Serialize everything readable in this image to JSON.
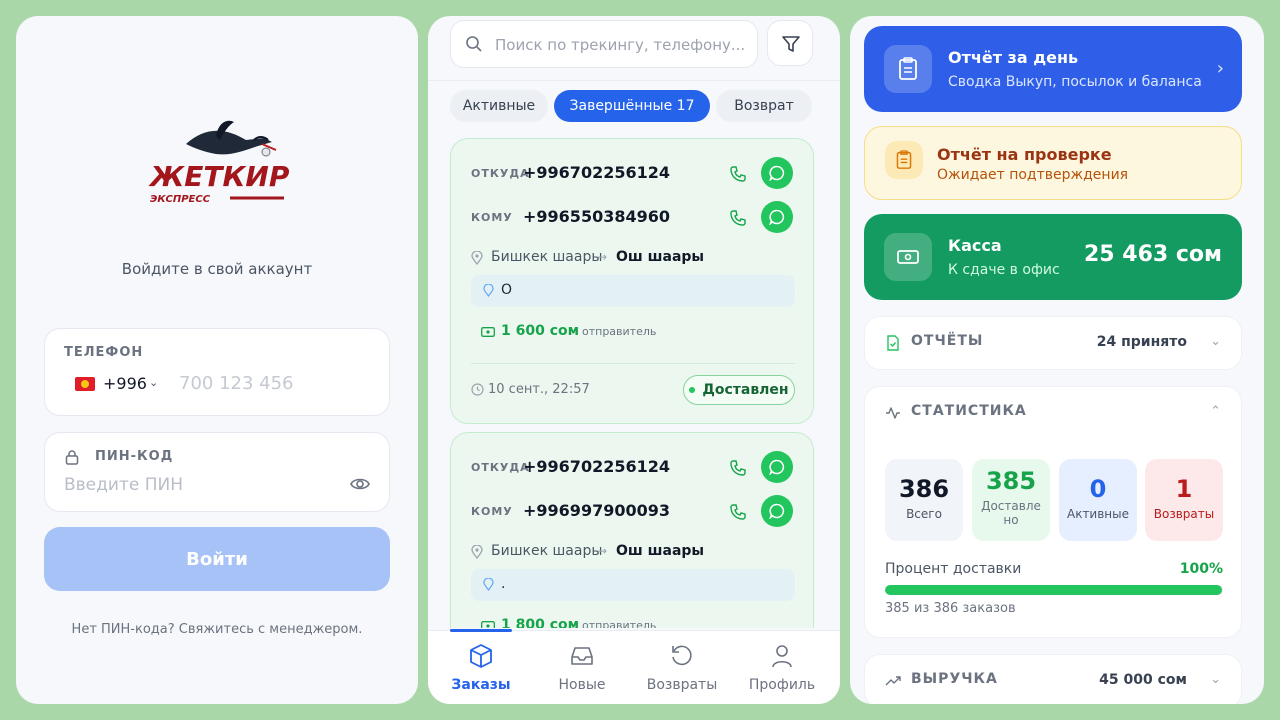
{
  "login": {
    "logo_text": "ЖЕТКИР",
    "logo_sub": "ЭКСПРЕСС",
    "title": "Войдите в свой аккаунт",
    "phone_label": "ТЕЛЕФОН",
    "country_code": "+996",
    "phone_placeholder": "700 123 456",
    "pin_label": "ПИН-КОД",
    "pin_placeholder": "Введите ПИН",
    "login_button": "Войти",
    "no_pin_text": "Нет ПИН-кода? Свяжитесь с менеджером."
  },
  "orders": {
    "search_placeholder": "Поиск по трекингу, телефону...",
    "tabs": [
      {
        "label": "Активные"
      },
      {
        "label": "Завершённые 17"
      },
      {
        "label": "Возврат"
      }
    ],
    "cards": [
      {
        "from_label": "ОТКУДА",
        "from_phone": "+996702256124",
        "to_label": "КОМУ",
        "to_phone": "+996550384960",
        "route_from": "Бишкек шаары",
        "route_to": "Ош шаары",
        "address": "О",
        "amount": "1 600 сом",
        "payer": "· отправитель",
        "date": "10 сент., 22:57",
        "status": "Доставлен"
      },
      {
        "from_label": "ОТКУДА",
        "from_phone": "+996702256124",
        "to_label": "КОМУ",
        "to_phone": "+996997900093",
        "route_from": "Бишкек шаары",
        "route_to": "Ош шаары",
        "address": ".",
        "amount": "1 800 сом",
        "payer": "· отправитель"
      }
    ],
    "nav": [
      {
        "label": "Заказы"
      },
      {
        "label": "Новые"
      },
      {
        "label": "Возвраты"
      },
      {
        "label": "Профиль"
      }
    ]
  },
  "dashboard": {
    "daily": {
      "title": "Отчёт за день",
      "subtitle": "Сводка Выкуп, посылок и баланса"
    },
    "check": {
      "title": "Отчёт на проверке",
      "subtitle": "Ожидает подтверждения"
    },
    "kassa": {
      "title": "Касса",
      "subtitle": "К сдаче в офис",
      "balance": "25 463 сом"
    },
    "reports": {
      "title": "ОТЧЁТЫ",
      "value": "24 принято"
    },
    "stats": {
      "title": "СТАТИСТИКА",
      "items": [
        {
          "value": "386",
          "label": "Всего"
        },
        {
          "value": "385",
          "label": "Доставле но"
        },
        {
          "value": "0",
          "label": "Активные"
        },
        {
          "value": "1",
          "label": "Возвраты"
        }
      ],
      "percent_label": "Процент доставки",
      "percent_value": "100%",
      "percent_fraction": 0.997,
      "summary": "385 из 386 заказов"
    },
    "revenue": {
      "title": "ВЫРУЧКА",
      "value": "45 000 сом"
    }
  },
  "colors": {
    "primary": "#2563eb",
    "success": "#22c55e",
    "kassa": "#149b62",
    "warning_bg": "#fef7e0"
  }
}
